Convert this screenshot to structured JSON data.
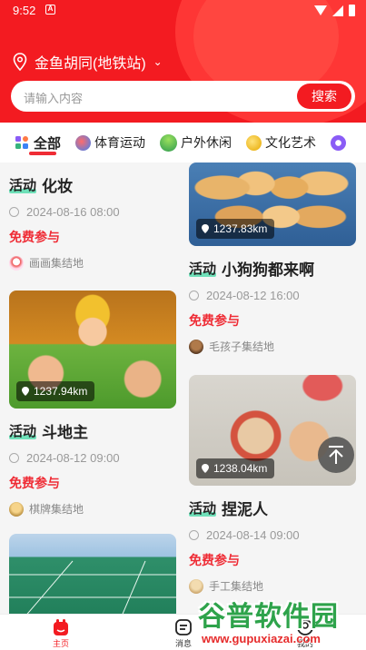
{
  "status": {
    "time": "9:52",
    "notif_icon": "A"
  },
  "header": {
    "location": "金鱼胡同(地铁站)",
    "search_placeholder": "请输入内容",
    "search_button": "搜索"
  },
  "categories": [
    {
      "label": "全部",
      "icon": "grid-icon",
      "active": true
    },
    {
      "label": "体育运动",
      "icon": "sports-icon"
    },
    {
      "label": "户外休闲",
      "icon": "outdoor-icon"
    },
    {
      "label": "文化艺术",
      "icon": "culture-icon"
    }
  ],
  "cards": [
    {
      "tag": "活动",
      "title": "化妆",
      "time": "2024-08-16 08:00",
      "price": "免费参与",
      "group": "画画集结地"
    },
    {
      "tag": "活动",
      "title": "小狗狗都来啊",
      "distance": "1237.83km",
      "time": "2024-08-12 16:00",
      "price": "免费参与",
      "group": "毛孩子集结地"
    },
    {
      "tag": "活动",
      "title": "斗地主",
      "distance": "1237.94km",
      "time": "2024-08-12 09:00",
      "price": "免费参与",
      "group": "棋牌集结地"
    },
    {
      "tag": "活动",
      "title": "捏泥人",
      "distance": "1238.04km",
      "time": "2024-08-14 09:00",
      "price": "免费参与",
      "group": "手工集结地"
    }
  ],
  "nav": {
    "home": "主页",
    "messages": "消息",
    "mine": "我的"
  },
  "watermark": {
    "name": "谷普软件园",
    "url": "www.gupuxiazai.com"
  },
  "colors": {
    "brand": "#f31b21",
    "accent_tag": "#6fe0b9",
    "price": "#ef2c35"
  }
}
